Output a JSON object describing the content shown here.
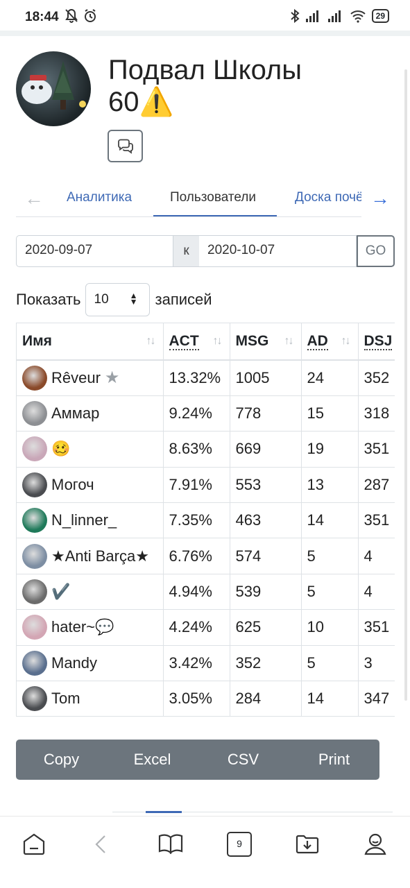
{
  "status_bar": {
    "time": "18:44",
    "battery": "29"
  },
  "group": {
    "title": "Подвал Школы 60⚠️"
  },
  "tabs": [
    {
      "label": "Аналитика"
    },
    {
      "label": "Пользователи"
    },
    {
      "label": "Доска почёта"
    }
  ],
  "date_range": {
    "from": "2020-09-07",
    "separator": "к",
    "to": "2020-10-07",
    "go_label": "GO"
  },
  "show_entries": {
    "prefix": "Показать",
    "value": "10",
    "suffix": "записей"
  },
  "table": {
    "columns": [
      "Имя",
      "ACT",
      "MSG",
      "AD",
      "DSJ"
    ],
    "rows": [
      {
        "name": "Rêveur",
        "act": "13.32%",
        "msg": "1005",
        "ad": "24",
        "dsj": "352",
        "avatar_color": "#8a4a2a",
        "starred": true
      },
      {
        "name": "Аммар",
        "act": "9.24%",
        "msg": "778",
        "ad": "15",
        "dsj": "318",
        "avatar_color": "#8d8f93"
      },
      {
        "name": "🥴",
        "act": "8.63%",
        "msg": "669",
        "ad": "19",
        "dsj": "351",
        "avatar_color": "#c9a7b8"
      },
      {
        "name": "Могоч",
        "act": "7.91%",
        "msg": "553",
        "ad": "13",
        "dsj": "287",
        "avatar_color": "#4a4c50"
      },
      {
        "name": "N_linner_",
        "act": "7.35%",
        "msg": "463",
        "ad": "14",
        "dsj": "351",
        "avatar_color": "#1f7a5a"
      },
      {
        "name": "★Anti Barça★",
        "act": "6.76%",
        "msg": "574",
        "ad": "5",
        "dsj": "4",
        "avatar_color": "#7d8ea3"
      },
      {
        "name": "✔️",
        "act": "4.94%",
        "msg": "539",
        "ad": "5",
        "dsj": "4",
        "avatar_color": "#6b6b6b"
      },
      {
        "name": "hater~💬",
        "act": "4.24%",
        "msg": "625",
        "ad": "10",
        "dsj": "351",
        "avatar_color": "#d3a6b4"
      },
      {
        "name": "Mandy",
        "act": "3.42%",
        "msg": "352",
        "ad": "5",
        "dsj": "3",
        "avatar_color": "#5a6f8e"
      },
      {
        "name": "Tom",
        "act": "3.05%",
        "msg": "284",
        "ad": "14",
        "dsj": "347",
        "avatar_color": "#4a4c50"
      }
    ]
  },
  "export_buttons": [
    "Copy",
    "Excel",
    "CSV",
    "Print"
  ],
  "bottom_nav": {
    "tabs_count": "9"
  },
  "colors": {
    "accent": "#3e69b5",
    "export_bg": "#6c757d",
    "border": "#dee2e6"
  },
  "icons": [
    "mute-icon",
    "alarm-icon",
    "bluetooth-icon",
    "signal-icon",
    "wifi-icon",
    "chat-icon",
    "arrow-left-icon",
    "arrow-right-icon",
    "sort-icon",
    "star-icon",
    "home-icon",
    "back-icon",
    "book-icon",
    "tabs-icon",
    "download-icon",
    "profile-icon"
  ]
}
